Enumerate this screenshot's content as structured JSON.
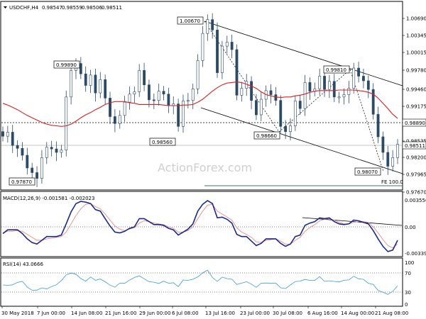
{
  "chart_data": {
    "type": "candlestick",
    "header": {
      "symbol_label": "USDCHF,H4",
      "ohlc_values": [
        "0.98547",
        "0.98559",
        "0.98506",
        "0.98511"
      ]
    },
    "watermark": "ActionForex.com",
    "x_tick_labels": [
      "30 May 2018",
      "7 Jun 00:00",
      "14 Jun 08:00",
      "21 Jun 16:00",
      "29 Jun 00:00",
      "6 Jul 08:00",
      "13 Jul 16:00",
      "23 Jul 00:00",
      "30 Jul 08:00",
      "6 Aug 16:00",
      "14 Aug 00:00",
      "21 Aug 08:00"
    ],
    "price_panel": {
      "y_ticks": [
        "1.00690",
        "1.00345",
        "1.00015",
        "0.99780",
        "0.99460",
        "0.99175",
        "0.98850",
        "0.98535",
        "0.98200",
        "0.97965",
        "0.97670"
      ],
      "current_price_label": "0.98511",
      "line_level_label": "0.98890",
      "moving_average": [
        0.9922,
        0.9919,
        0.9915,
        0.9911,
        0.9906,
        0.9901,
        0.9897,
        0.9893,
        0.9889,
        0.9886,
        0.9884,
        0.9883,
        0.9882,
        0.9883,
        0.9886,
        0.9891,
        0.9897,
        0.9902,
        0.9906,
        0.9911,
        0.9915,
        0.992,
        0.9923,
        0.9925,
        0.9925,
        0.9925,
        0.9923,
        0.9922,
        0.992,
        0.992,
        0.992,
        0.992,
        0.992,
        0.9919,
        0.9918,
        0.9918,
        0.9918,
        0.9919,
        0.9919,
        0.992,
        0.9924,
        0.9929,
        0.9936,
        0.9943,
        0.9949,
        0.9954,
        0.9957,
        0.9958,
        0.9959,
        0.9958,
        0.9955,
        0.9952,
        0.9948,
        0.9942,
        0.9937,
        0.9935,
        0.9933,
        0.9932,
        0.9933,
        0.9933,
        0.9935,
        0.9936,
        0.9938,
        0.9941,
        0.9943,
        0.9944,
        0.9944,
        0.9944,
        0.9944,
        0.9945,
        0.9945,
        0.9945,
        0.9945,
        0.9944,
        0.9943,
        0.9941,
        0.9938,
        0.9931,
        0.9922,
        0.9913,
        0.9903,
        0.9896
      ],
      "candle_close": [
        0.9865,
        0.9872,
        0.9849,
        0.9844,
        0.9832,
        0.981,
        0.9802,
        0.9792,
        0.9828,
        0.9846,
        0.9843,
        0.9837,
        0.9841,
        0.9933,
        0.9979,
        0.9991,
        0.9973,
        0.9953,
        0.9971,
        0.994,
        0.9963,
        0.9931,
        0.9899,
        0.9887,
        0.9901,
        0.9924,
        0.9938,
        0.9942,
        0.9979,
        0.9954,
        0.9928,
        0.9927,
        0.9943,
        0.9938,
        0.9918,
        0.9921,
        0.9882,
        0.9926,
        0.9927,
        0.9947,
        0.9996,
        1.0043,
        1.0067,
        1.0049,
        0.9975,
        1.0021,
        1.0028,
        1.0015,
        0.9936,
        0.9948,
        0.996,
        0.9927,
        0.9902,
        0.9929,
        0.9944,
        0.9937,
        0.9927,
        0.9882,
        0.9873,
        0.9883,
        0.9926,
        0.9913,
        0.9958,
        0.9943,
        0.9947,
        0.9969,
        0.9946,
        0.996,
        0.9933,
        0.9933,
        0.9937,
        0.9948,
        0.9983,
        0.9969,
        0.9961,
        0.9946,
        0.9903,
        0.9864,
        0.9837,
        0.9813,
        0.9828,
        0.9851
      ],
      "fib_label": "FE 100.0",
      "annotations": [
        {
          "text": "1.00670",
          "price": 1.0067
        },
        {
          "text": "0.99890",
          "price": 0.9989
        },
        {
          "text": "0.98560",
          "price": 0.9856
        },
        {
          "text": "0.97870",
          "price": 0.9787
        },
        {
          "text": "0.99810",
          "price": 0.9981
        },
        {
          "text": "0.98660",
          "price": 0.9866
        },
        {
          "text": "0.98070",
          "price": 0.9807
        }
      ]
    },
    "macd_panel": {
      "label": "MACD(12,26,9) -0.001581 -0.002023",
      "y_ticks": [
        "0.003556",
        "0.00",
        "-0.003391"
      ],
      "macd_line": [
        -0.0009,
        -0.0004,
        -0.0004,
        -0.0004,
        -0.0009,
        -0.0016,
        -0.0021,
        -0.0023,
        -0.0018,
        -0.0013,
        -0.0013,
        -0.0013,
        -0.0011,
        0.0004,
        0.002,
        0.0031,
        0.0034,
        0.0033,
        0.0031,
        0.0023,
        0.0021,
        0.0011,
        0.0001,
        -0.0007,
        -0.0008,
        -0.0006,
        -0.0002,
        0.0,
        0.0011,
        0.0011,
        0.0007,
        0.0003,
        0.0003,
        0.0002,
        -0.0002,
        -0.0004,
        -0.0011,
        -0.0007,
        -0.0003,
        0.0004,
        0.0021,
        0.003,
        0.0035,
        0.0031,
        0.0012,
        0.0013,
        0.001,
        0.0005,
        -0.001,
        -0.0013,
        -0.0013,
        -0.0019,
        -0.0025,
        -0.0022,
        -0.0016,
        -0.0016,
        -0.0016,
        -0.0022,
        -0.0026,
        -0.0023,
        -0.0013,
        -0.0011,
        0.0002,
        0.0005,
        0.0007,
        0.0012,
        0.0011,
        0.0012,
        0.0007,
        0.0004,
        0.0003,
        0.0004,
        0.0009,
        0.0008,
        0.0006,
        0.0004,
        -0.0005,
        -0.0016,
        -0.0026,
        -0.0033,
        -0.0031,
        -0.0018
      ],
      "signal_line": [
        -0.0008,
        -0.0006,
        -0.0006,
        -0.0005,
        -0.0006,
        -0.001,
        -0.0014,
        -0.0018,
        -0.0018,
        -0.0016,
        -0.0015,
        -0.0014,
        -0.0013,
        -0.0007,
        0.0004,
        0.0015,
        0.0024,
        0.003,
        0.0031,
        0.0027,
        0.0024,
        0.0017,
        0.0009,
        0.0001,
        -0.0003,
        -0.0005,
        -0.0003,
        -0.0001,
        0.0005,
        0.0008,
        0.0007,
        0.0005,
        0.0004,
        0.0003,
        0.0,
        -0.0002,
        -0.0007,
        -0.0007,
        -0.0005,
        0.0,
        0.0011,
        0.0021,
        0.0029,
        0.003,
        0.0021,
        0.0017,
        0.0013,
        0.0009,
        -0.0001,
        -0.0007,
        -0.001,
        -0.0014,
        -0.002,
        -0.0021,
        -0.0018,
        -0.0017,
        -0.0016,
        -0.0019,
        -0.0023,
        -0.0023,
        -0.0018,
        -0.0014,
        -0.0006,
        -0.0001,
        0.0003,
        0.0008,
        0.001,
        0.0011,
        0.0009,
        0.0006,
        0.0004,
        0.0004,
        0.0006,
        0.0007,
        0.0007,
        0.0006,
        0.0,
        -0.0008,
        -0.0017,
        -0.0025,
        -0.0028,
        -0.0023
      ]
    },
    "rsi_panel": {
      "label": "RSI(14) 43.0666",
      "y_ticks": [
        "100",
        "70",
        "30",
        "0"
      ],
      "values": [
        44.8,
        44.1,
        45.1,
        50.1,
        52.6,
        40.4,
        33.7,
        33.9,
        38.8,
        36.2,
        41.5,
        45.2,
        54.0,
        65.9,
        69.8,
        67.5,
        58.4,
        52.8,
        61.6,
        54.6,
        57.3,
        51.5,
        44.5,
        40.2,
        48.5,
        48.2,
        55.1,
        60.5,
        64.0,
        57.8,
        51.6,
        50.6,
        47.9,
        52.9,
        48.4,
        49.5,
        41.4,
        55.2,
        54.5,
        56.9,
        61.8,
        70.1,
        75.9,
        60.6,
        52.2,
        61.3,
        58.1,
        56.9,
        45.8,
        48.7,
        51.6,
        46.6,
        39.9,
        48.4,
        49.0,
        48.0,
        48.6,
        38.9,
        37.1,
        44.9,
        52.1,
        52.9,
        56.6,
        54.3,
        54.4,
        62.4,
        52.3,
        53.6,
        52.2,
        51.1,
        54.7,
        55.4,
        63.2,
        57.8,
        56.5,
        48.3,
        46.0,
        33.2,
        29.4,
        24.9,
        31.3,
        43.1
      ]
    }
  }
}
